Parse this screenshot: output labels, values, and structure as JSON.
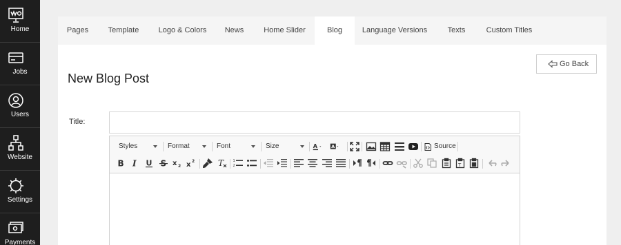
{
  "sidebar": {
    "items": [
      {
        "label": "Home",
        "icon": "home-board-icon"
      },
      {
        "label": "Jobs",
        "icon": "jobs-icon"
      },
      {
        "label": "Users",
        "icon": "user-icon"
      },
      {
        "label": "Website",
        "icon": "sitemap-icon"
      },
      {
        "label": "Settings",
        "icon": "gear-icon"
      },
      {
        "label": "Payments",
        "icon": "payments-icon"
      }
    ]
  },
  "tabs": [
    "Pages",
    "Template",
    "Logo & Colors",
    "News",
    "Home Slider",
    "Blog",
    "Language Versions",
    "Texts",
    "Custom Titles"
  ],
  "active_tab": "Blog",
  "page": {
    "title": "New Blog Post",
    "go_back": "Go Back",
    "title_label": "Title:",
    "title_value": ""
  },
  "editor": {
    "combos": [
      "Styles",
      "Format",
      "Font",
      "Size"
    ],
    "source_label": "Source"
  },
  "colors": {
    "sidebar_bg": "#1e1e1e",
    "page_bg": "#efefef",
    "tab_bar_bg": "#f5f5f5"
  }
}
